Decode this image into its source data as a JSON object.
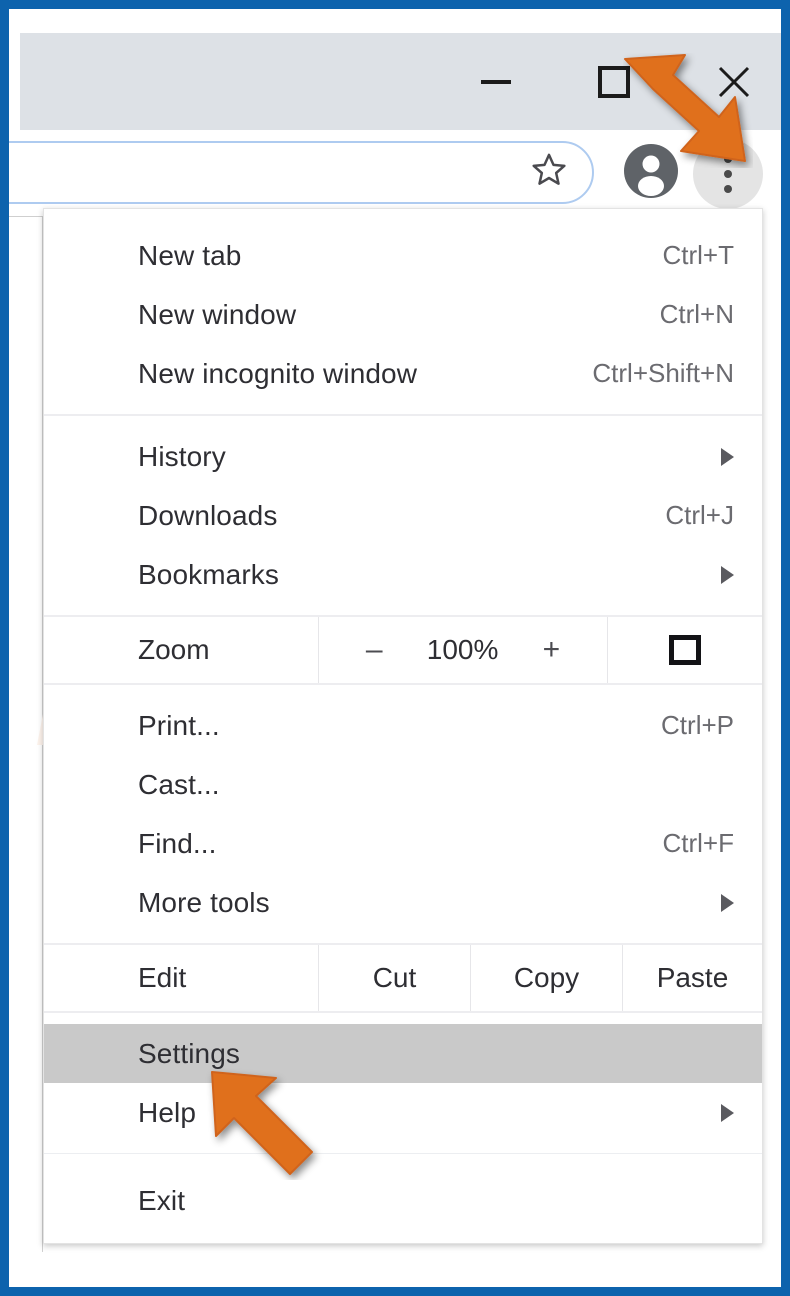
{
  "window": {
    "controls": {
      "minimize_label": "minimize",
      "maximize_label": "maximize",
      "close_label": "close"
    }
  },
  "toolbar": {
    "omnibox_value": "",
    "omnibox_placeholder": "",
    "bookmark_star_label": "Bookmark this tab",
    "profile_label": "Profile",
    "menu_button_label": "Customize and control Google Chrome"
  },
  "watermark": {
    "line1": "PC",
    "line2": "risk.com"
  },
  "menu": {
    "groups": [
      {
        "id": "new",
        "items": [
          {
            "label": "New tab",
            "accel": "Ctrl+T",
            "submenu": false,
            "selected": false
          },
          {
            "label": "New window",
            "accel": "Ctrl+N",
            "submenu": false,
            "selected": false
          },
          {
            "label": "New incognito window",
            "accel": "Ctrl+Shift+N",
            "submenu": false,
            "selected": false
          }
        ]
      },
      {
        "id": "browse",
        "items": [
          {
            "label": "History",
            "accel": "",
            "submenu": true,
            "selected": false
          },
          {
            "label": "Downloads",
            "accel": "Ctrl+J",
            "submenu": false,
            "selected": false
          },
          {
            "label": "Bookmarks",
            "accel": "",
            "submenu": true,
            "selected": false
          }
        ]
      },
      {
        "id": "tools",
        "items": [
          {
            "label": "Print...",
            "accel": "Ctrl+P",
            "submenu": false,
            "selected": false
          },
          {
            "label": "Cast...",
            "accel": "",
            "submenu": false,
            "selected": false
          },
          {
            "label": "Find...",
            "accel": "Ctrl+F",
            "submenu": false,
            "selected": false
          },
          {
            "label": "More tools",
            "accel": "",
            "submenu": true,
            "selected": false
          }
        ]
      },
      {
        "id": "bottom",
        "items": [
          {
            "label": "Settings",
            "accel": "",
            "submenu": false,
            "selected": true
          },
          {
            "label": "Help",
            "accel": "",
            "submenu": true,
            "selected": false
          }
        ]
      },
      {
        "id": "exit",
        "items": [
          {
            "label": "Exit",
            "accel": "",
            "submenu": false,
            "selected": false
          }
        ]
      }
    ],
    "zoom_row": {
      "label": "Zoom",
      "minus_label": "–",
      "value": "100%",
      "plus_label": "+",
      "fullscreen_label": "Full screen"
    },
    "edit_row": {
      "label": "Edit",
      "cut_label": "Cut",
      "copy_label": "Copy",
      "paste_label": "Paste"
    }
  },
  "annotations": {
    "arrow_top_target": "menu-button",
    "arrow_bottom_target": "Settings",
    "arrow_color": "#e0701f"
  },
  "colors": {
    "frame_blue": "#0d63ad",
    "titlebar": "#dde1e6",
    "omnibox_border": "#aecbf0",
    "highlight": "#c9c9c9",
    "arrow_orange": "#e0701f",
    "menu_text": "#2e2e33",
    "accel_text": "#6b6b70"
  }
}
